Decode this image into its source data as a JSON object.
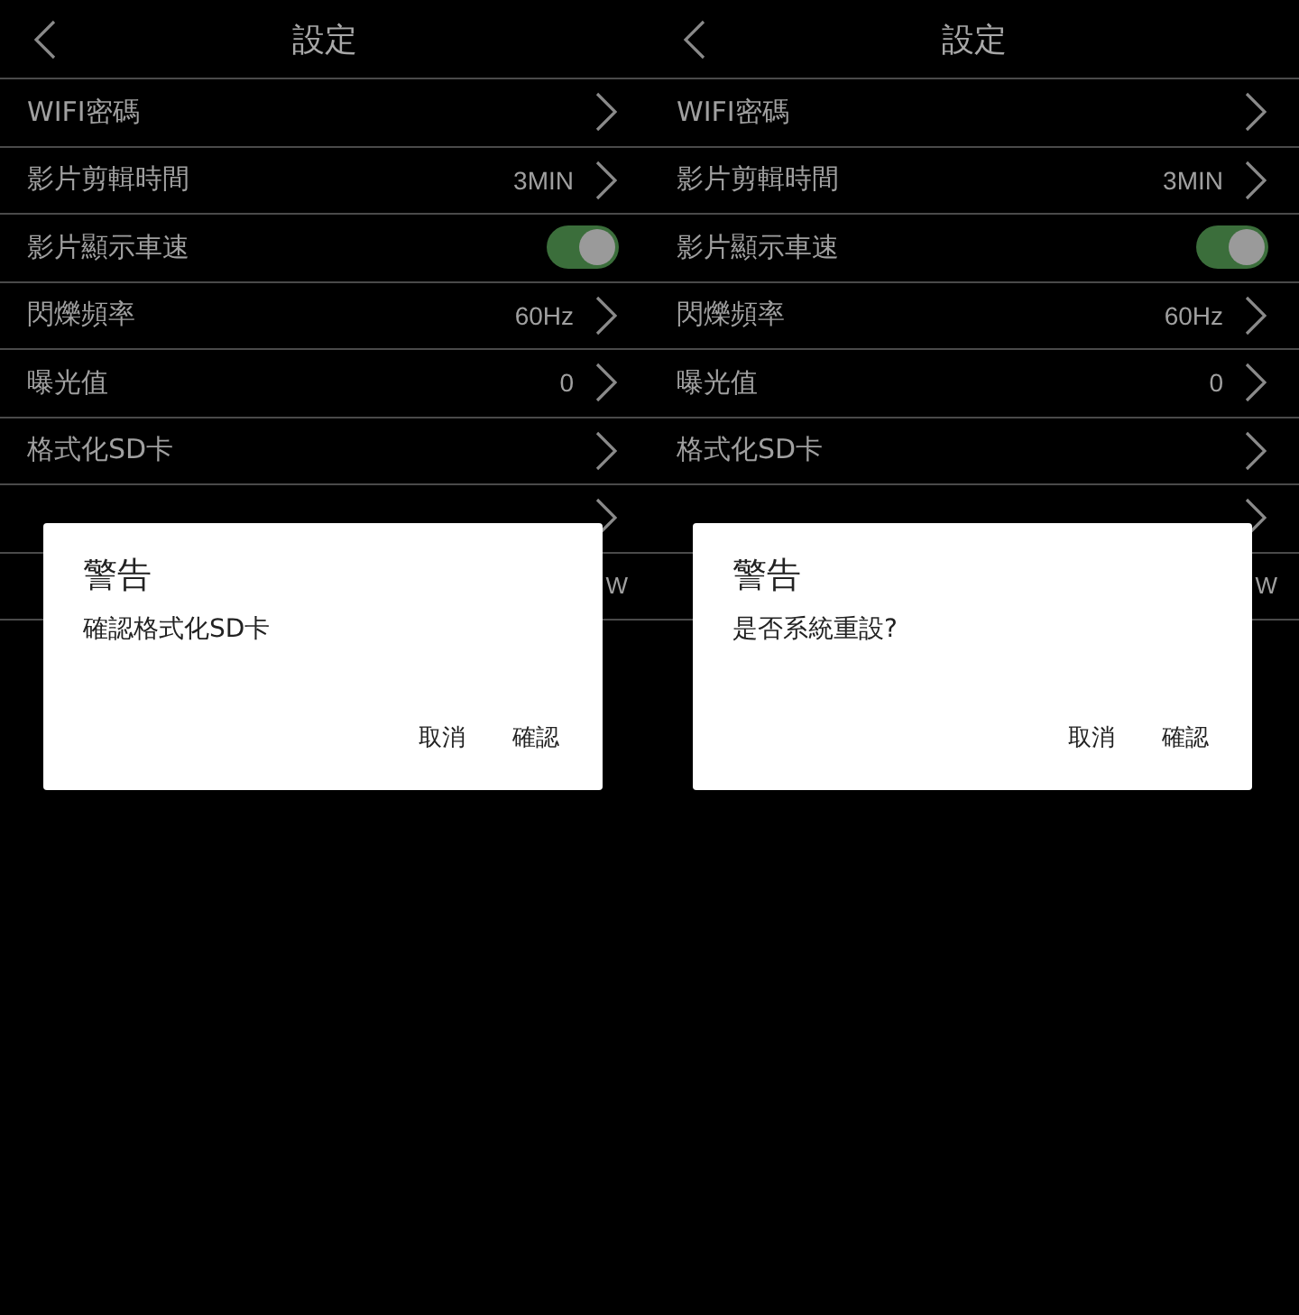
{
  "screens": [
    {
      "title": "設定",
      "rows": [
        {
          "kind": "link",
          "label": "WIFI密碼"
        },
        {
          "kind": "link",
          "label": "影片剪輯時間",
          "value": "3MIN"
        },
        {
          "kind": "toggle",
          "label": "影片顯示車速",
          "on": true
        },
        {
          "kind": "link",
          "label": "閃爍頻率",
          "value": "60Hz"
        },
        {
          "kind": "link",
          "label": "曝光值",
          "value": "0"
        },
        {
          "kind": "link",
          "label": "格式化SD卡"
        },
        {
          "kind": "link"
        },
        {
          "kind": "value",
          "value": "W"
        }
      ],
      "dialog": {
        "title": "警告",
        "message": "確認格式化SD卡",
        "buttons": [
          "取消",
          "確認"
        ]
      }
    },
    {
      "title": "設定",
      "rows": [
        {
          "kind": "link",
          "label": "WIFI密碼"
        },
        {
          "kind": "link",
          "label": "影片剪輯時間",
          "value": "3MIN"
        },
        {
          "kind": "toggle",
          "label": "影片顯示車速",
          "on": true
        },
        {
          "kind": "link",
          "label": "閃爍頻率",
          "value": "60Hz"
        },
        {
          "kind": "link",
          "label": "曝光值",
          "value": "0"
        },
        {
          "kind": "link",
          "label": "格式化SD卡"
        },
        {
          "kind": "link"
        },
        {
          "kind": "value",
          "value": "W"
        }
      ],
      "dialog": {
        "title": "警告",
        "message": "是否系統重設?",
        "buttons": [
          "取消",
          "確認"
        ]
      }
    }
  ]
}
